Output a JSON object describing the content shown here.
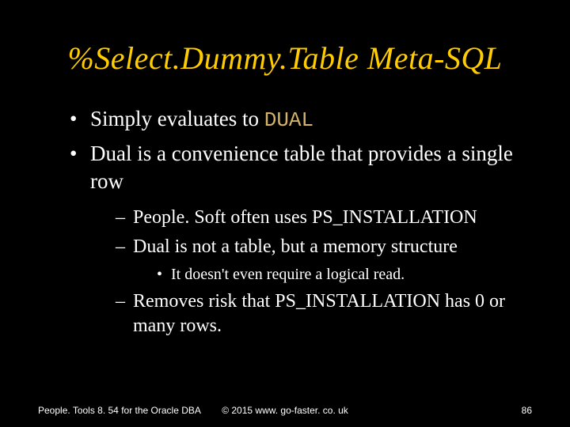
{
  "title": "%Select.Dummy.Table Meta-SQL",
  "bullets": {
    "b1_prefix": "Simply evaluates to ",
    "b1_code": "DUAL",
    "b2": "Dual is a convenience table that provides a single row",
    "sub1": "People. Soft often uses PS_INSTALLATION",
    "sub2": "Dual is not a table, but a memory structure",
    "sub2_sub1": "It doesn't even require a logical read.",
    "sub3": "Removes risk that PS_INSTALLATION has 0 or many rows."
  },
  "footer": {
    "left": "People. Tools 8. 54 for the Oracle DBA",
    "center": "© 2015 www. go-faster. co. uk",
    "right": "86"
  }
}
